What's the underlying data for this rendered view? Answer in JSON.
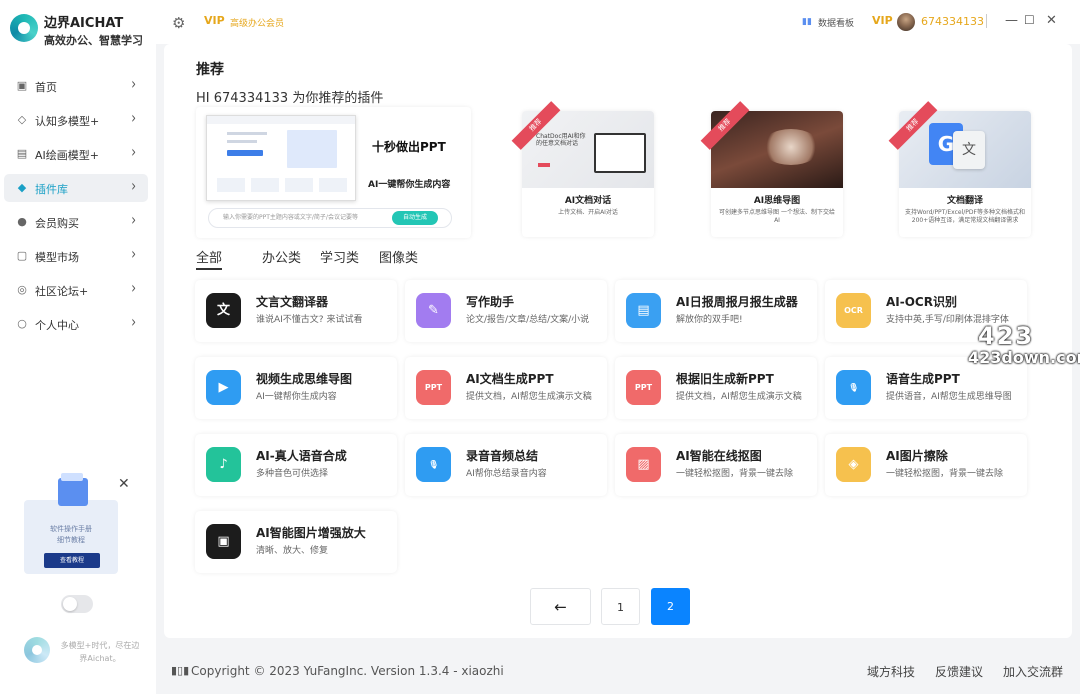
{
  "app": {
    "name": "边界AICHAT",
    "slogan": "高效办公、智慧学习"
  },
  "sidebar": {
    "items": [
      {
        "label": "首页",
        "icon": "home-icon",
        "glyph": "▣"
      },
      {
        "label": "认知多模型+",
        "icon": "cube-icon",
        "glyph": "◇"
      },
      {
        "label": "AI绘画模型+",
        "icon": "image-icon",
        "glyph": "▤"
      },
      {
        "label": "插件库",
        "icon": "plugin-icon",
        "glyph": "◆",
        "active": true
      },
      {
        "label": "会员购买",
        "icon": "user-icon",
        "glyph": "●"
      },
      {
        "label": "模型市场",
        "icon": "market-icon",
        "glyph": "▢"
      },
      {
        "label": "社区论坛+",
        "icon": "community-icon",
        "glyph": "◎"
      },
      {
        "label": "个人中心",
        "icon": "profile-icon",
        "glyph": "○"
      }
    ],
    "promo": {
      "line1": "软件操作手册",
      "line2": "细节教程",
      "button": "查看教程"
    },
    "footer_text": "多模型+时代，尽在边界Aichat。"
  },
  "topbar": {
    "vip_badge": "VIP",
    "vip_label": "高级办公会员",
    "dashboard": "数据看板",
    "user_id": "674334133"
  },
  "main": {
    "title": "推荐",
    "greeting": "HI 674334133 为你推荐的插件",
    "banner": {
      "title": "十秒做出PPT",
      "subtitle": "AI一键帮你生成内容",
      "input_placeholder": "输入你需要的PPT主题内容或文字/简子/会议记要等",
      "button": "自动生成"
    },
    "featured": [
      {
        "ribbon": "推荐",
        "title": "AI文档对话",
        "desc": "上传文档、开启AI对话",
        "img_text": "ChatDoc用AI和你的任意文档对话"
      },
      {
        "ribbon": "推荐",
        "title": "AI思维导图",
        "desc": "可创建多节点思维导图 一个想法、制下交给AI"
      },
      {
        "ribbon": "推荐",
        "title": "文档翻译",
        "desc": "支持Word/PPT/Excel/PDF等多种文档格式和200+语种互译，满足常规文档翻译需求"
      }
    ],
    "tabs": [
      "全部",
      "办公类",
      "学习类",
      "图像类"
    ],
    "plugins": [
      {
        "title": "文言文翻译器",
        "desc": "谁说AI不懂古文? 来试试看",
        "icon": "classical-chinese-icon",
        "glyph": "文",
        "color": "#1c1c1c"
      },
      {
        "title": "写作助手",
        "desc": "论文/报告/文章/总结/文案/小说",
        "icon": "pen-icon",
        "glyph": "✎",
        "color": "#a27cf0"
      },
      {
        "title": "AI日报周报月报生成器",
        "desc": "解放你的双手吧!",
        "icon": "report-icon",
        "glyph": "▤",
        "color": "#3aa0f2"
      },
      {
        "title": "AI-OCR识别",
        "desc": "支持中英,手写/印刷体混排字体",
        "icon": "ocr-icon",
        "glyph": "OCR",
        "color": "#f6c14e"
      },
      {
        "title": "视频生成思维导图",
        "desc": "AI一键帮你生成内容",
        "icon": "video-icon",
        "glyph": "▶",
        "color": "#2f9cf2"
      },
      {
        "title": "AI文档生成PPT",
        "desc": "提供文档，AI帮您生成演示文稿",
        "icon": "ppt-icon",
        "glyph": "PPT",
        "color": "#f06a6a"
      },
      {
        "title": "根据旧生成新PPT",
        "desc": "提供文档，AI帮您生成演示文稿",
        "icon": "ppt-icon",
        "glyph": "PPT",
        "color": "#f06a6a"
      },
      {
        "title": "语音生成PPT",
        "desc": "提供语音，AI帮您生成思维导图",
        "icon": "microphone-icon",
        "glyph": "🎙",
        "color": "#2f9cf2"
      },
      {
        "title": "AI-真人语音合成",
        "desc": "多种音色可供选择",
        "icon": "voice-icon",
        "glyph": "♪",
        "color": "#23c39a"
      },
      {
        "title": "录音音频总结",
        "desc": "AI帮你总结录音内容",
        "icon": "microphone-icon",
        "glyph": "🎙",
        "color": "#2f9cf2"
      },
      {
        "title": "AI智能在线抠图",
        "desc": "一键轻松抠图，背景一键去除",
        "icon": "cutout-icon",
        "glyph": "▨",
        "color": "#f06a6a"
      },
      {
        "title": "AI图片擦除",
        "desc": "一键轻松抠图，背景一键去除",
        "icon": "eraser-icon",
        "glyph": "◈",
        "color": "#f6c14e"
      },
      {
        "title": "AI智能图片增强放大",
        "desc": "清晰、放大、修复",
        "icon": "enhance-icon",
        "glyph": "▣",
        "color": "#1c1c1c"
      }
    ],
    "pager": {
      "prev": "←",
      "pages": [
        "1",
        "2"
      ],
      "current": "2"
    }
  },
  "footer": {
    "copyright": "Copyright © 2023 YuFangInc. Version 1.3.4 - xiaozhi",
    "links": [
      "域方科技",
      "反馈建议",
      "加入交流群"
    ]
  },
  "watermark": {
    "top": "423",
    "bottom": "423down.com"
  }
}
